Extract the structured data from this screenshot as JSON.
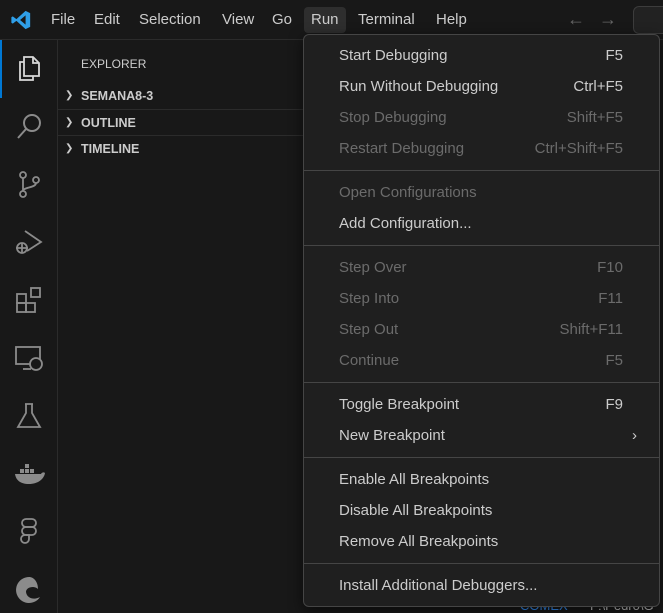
{
  "titlebar": {
    "menus": [
      "File",
      "Edit",
      "Selection",
      "View",
      "Go",
      "Run",
      "Terminal",
      "Help"
    ],
    "active_menu": "Run",
    "back_icon": "arrow-left-icon",
    "forward_icon": "arrow-right-icon"
  },
  "activity_bar": {
    "items": [
      "explorer",
      "search",
      "source-control",
      "run-and-debug",
      "extensions",
      "remote-explorer",
      "testing",
      "docker",
      "figma",
      "edge-devtools"
    ],
    "accent": "#0078d4"
  },
  "sidebar": {
    "title": "EXPLORER",
    "sections": [
      "SEMANA8-3",
      "OUTLINE",
      "TIMELINE"
    ]
  },
  "background_text": {
    "a": "COMEX",
    "b": "F:\\Pedro\\G"
  },
  "run_menu": {
    "groups": [
      [
        {
          "label": "Start Debugging",
          "key": "F5",
          "enabled": true
        },
        {
          "label": "Run Without Debugging",
          "key": "Ctrl+F5",
          "enabled": true
        },
        {
          "label": "Stop Debugging",
          "key": "Shift+F5",
          "enabled": false
        },
        {
          "label": "Restart Debugging",
          "key": "Ctrl+Shift+F5",
          "enabled": false
        }
      ],
      [
        {
          "label": "Open Configurations",
          "key": "",
          "enabled": false
        },
        {
          "label": "Add Configuration...",
          "key": "",
          "enabled": true
        }
      ],
      [
        {
          "label": "Step Over",
          "key": "F10",
          "enabled": false
        },
        {
          "label": "Step Into",
          "key": "F11",
          "enabled": false
        },
        {
          "label": "Step Out",
          "key": "Shift+F11",
          "enabled": false
        },
        {
          "label": "Continue",
          "key": "F5",
          "enabled": false
        }
      ],
      [
        {
          "label": "Toggle Breakpoint",
          "key": "F9",
          "enabled": true
        },
        {
          "label": "New Breakpoint",
          "key": "",
          "enabled": true,
          "submenu": true
        }
      ],
      [
        {
          "label": "Enable All Breakpoints",
          "key": "",
          "enabled": true
        },
        {
          "label": "Disable All Breakpoints",
          "key": "",
          "enabled": true
        },
        {
          "label": "Remove All Breakpoints",
          "key": "",
          "enabled": true
        }
      ],
      [
        {
          "label": "Install Additional Debuggers...",
          "key": "",
          "enabled": true
        }
      ]
    ]
  }
}
